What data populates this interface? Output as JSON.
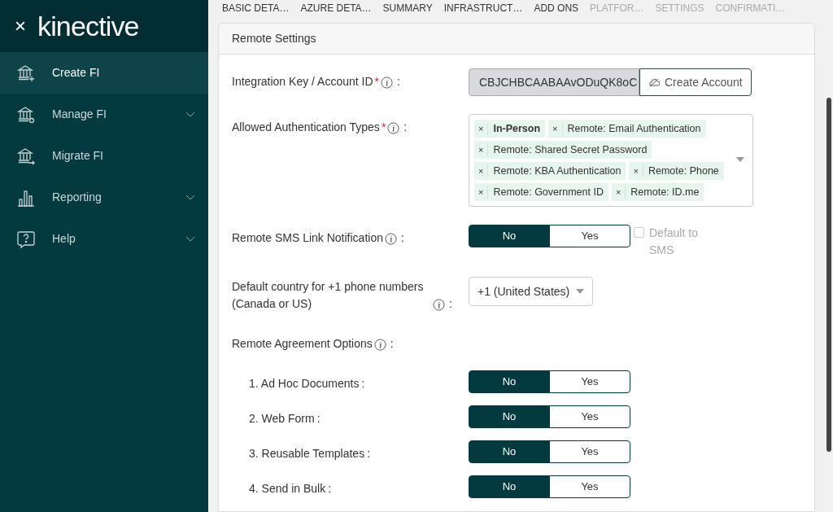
{
  "sidebar": {
    "close_label": "×",
    "logo": "kinective",
    "items": [
      {
        "label": "Create FI",
        "selected": true,
        "has_submenu": false
      },
      {
        "label": "Manage FI",
        "selected": false,
        "has_submenu": true
      },
      {
        "label": "Migrate FI",
        "selected": false,
        "has_submenu": false
      },
      {
        "label": "Reporting",
        "selected": false,
        "has_submenu": true
      },
      {
        "label": "Help",
        "selected": false,
        "has_submenu": true
      }
    ]
  },
  "steps": [
    {
      "label": "BASIC DETA…",
      "enabled": true
    },
    {
      "label": "AZURE DETA…",
      "enabled": true
    },
    {
      "label": "SUMMARY",
      "enabled": true
    },
    {
      "label": "INFRASTRUCT…",
      "enabled": true
    },
    {
      "label": "ADD ONS",
      "enabled": true
    },
    {
      "label": "PLATFOR…",
      "enabled": false
    },
    {
      "label": "SETTINGS",
      "enabled": false
    },
    {
      "label": "CONFIRMATI…",
      "enabled": false
    }
  ],
  "card": {
    "title": "Remote Settings",
    "fields": [
      {
        "kind": "key",
        "label": "Integration Key / Account ID",
        "required": "*",
        "info": true,
        "colon": ":",
        "value": "CBJCHBCAABAAvODuQK8oC",
        "button": "Create Account"
      },
      {
        "kind": "tags",
        "label": "Allowed Authentication Types",
        "required": "*",
        "info": true,
        "colon": ":",
        "tags": [
          {
            "label": "In-Person",
            "bold": true,
            "remove": "×"
          },
          {
            "label": "Remote: Email Authentication",
            "bold": false,
            "remove": "×"
          },
          {
            "label": "Remote: Shared Secret Password",
            "bold": false,
            "remove": "×"
          },
          {
            "label": "Remote: KBA Authentication",
            "bold": false,
            "remove": "×"
          },
          {
            "label": "Remote: Phone",
            "bold": false,
            "remove": "×"
          },
          {
            "label": "Remote: Government ID",
            "bold": false,
            "remove": "×"
          },
          {
            "label": "Remote: ID.me",
            "bold": false,
            "remove": "×"
          }
        ]
      },
      {
        "kind": "toggle",
        "label": "Remote SMS Link Notification",
        "info": true,
        "colon": ":",
        "options": [
          {
            "label": "No",
            "selected": true
          },
          {
            "label": "Yes",
            "selected": false
          }
        ],
        "checkbox": {
          "label": "Default to SMS",
          "checked": false,
          "disabled": true
        }
      },
      {
        "kind": "select",
        "label": "Default country for +1 phone numbers (Canada or US)",
        "info": true,
        "colon": ":",
        "value": "+1 (United States)"
      },
      {
        "kind": "heading",
        "label": "Remote Agreement Options",
        "info": true,
        "colon": ":"
      },
      {
        "kind": "option",
        "label": "1. Ad Hoc Documents",
        "colon": ":",
        "options": [
          {
            "label": "No",
            "selected": true
          },
          {
            "label": "Yes",
            "selected": false
          }
        ]
      },
      {
        "kind": "option",
        "label": "2. Web Form",
        "colon": ":",
        "options": [
          {
            "label": "No",
            "selected": true
          },
          {
            "label": "Yes",
            "selected": false
          }
        ]
      },
      {
        "kind": "option",
        "label": "3. Reusable Templates",
        "colon": ":",
        "options": [
          {
            "label": "No",
            "selected": true
          },
          {
            "label": "Yes",
            "selected": false
          }
        ]
      },
      {
        "kind": "option",
        "label": "4. Send in Bulk",
        "colon": ":",
        "options": [
          {
            "label": "No",
            "selected": true
          },
          {
            "label": "Yes",
            "selected": false
          }
        ]
      }
    ]
  }
}
